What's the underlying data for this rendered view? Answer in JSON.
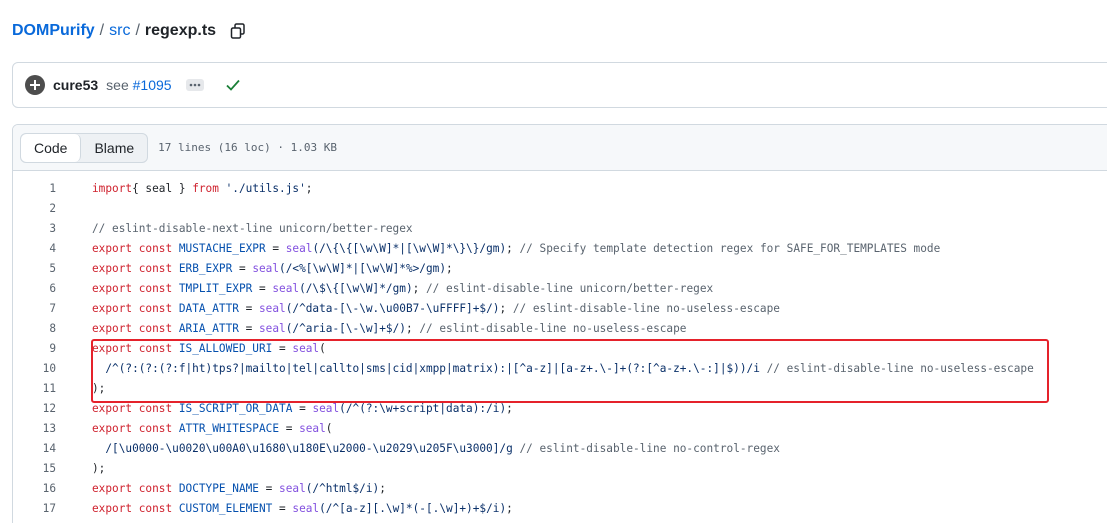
{
  "breadcrumb": {
    "repo": "DOMPurify",
    "sep1": "/",
    "dir": "src",
    "sep2": "/",
    "file": "regexp.ts"
  },
  "commit": {
    "author": "cure53",
    "message_prefix": "see",
    "message_link": "#1095"
  },
  "file_header": {
    "tab_code": "Code",
    "tab_blame": "Blame",
    "meta": "17 lines (16 loc) · 1.03 KB"
  },
  "colors": {
    "accent": "#0969da",
    "highlight": "#e5222b",
    "success": "#1a7f37"
  },
  "lines": [
    {
      "n": "1",
      "tokens": [
        [
          "k",
          "import"
        ],
        [
          "",
          "{ seal } "
        ],
        [
          "k",
          "from"
        ],
        [
          "s",
          " './utils.js'"
        ],
        [
          "",
          ";"
        ]
      ]
    },
    {
      "n": "2",
      "tokens": []
    },
    {
      "n": "3",
      "tokens": [
        [
          "c",
          "// eslint-disable-next-line unicorn/better-regex"
        ]
      ]
    },
    {
      "n": "4",
      "tokens": [
        [
          "k",
          "export const"
        ],
        [
          "v",
          " MUSTACHE_EXPR"
        ],
        [
          "",
          " = "
        ],
        [
          "f",
          "seal"
        ],
        [
          "s",
          "(/\\{\\{[\\w\\W]*|[\\w\\W]*\\}\\}/gm)"
        ],
        [
          "",
          "; "
        ],
        [
          "c",
          "// Specify template detection regex for SAFE_FOR_TEMPLATES mode"
        ]
      ]
    },
    {
      "n": "5",
      "tokens": [
        [
          "k",
          "export const"
        ],
        [
          "v",
          " ERB_EXPR"
        ],
        [
          "",
          " = "
        ],
        [
          "f",
          "seal"
        ],
        [
          "s",
          "(/<%[\\w\\W]*|[\\w\\W]*%>/gm)"
        ],
        [
          "",
          ";"
        ]
      ]
    },
    {
      "n": "6",
      "tokens": [
        [
          "k",
          "export const"
        ],
        [
          "v",
          " TMPLIT_EXPR"
        ],
        [
          "",
          " = "
        ],
        [
          "f",
          "seal"
        ],
        [
          "s",
          "(/\\$\\{[\\w\\W]*/gm)"
        ],
        [
          "",
          "; "
        ],
        [
          "c",
          "// eslint-disable-line unicorn/better-regex"
        ]
      ]
    },
    {
      "n": "7",
      "tokens": [
        [
          "k",
          "export const"
        ],
        [
          "v",
          " DATA_ATTR"
        ],
        [
          "",
          " = "
        ],
        [
          "f",
          "seal"
        ],
        [
          "s",
          "(/^data-[\\-\\w.\\u00B7-\\uFFFF]+$/)"
        ],
        [
          "",
          "; "
        ],
        [
          "c",
          "// eslint-disable-line no-useless-escape"
        ]
      ]
    },
    {
      "n": "8",
      "tokens": [
        [
          "k",
          "export const"
        ],
        [
          "v",
          " ARIA_ATTR"
        ],
        [
          "",
          " = "
        ],
        [
          "f",
          "seal"
        ],
        [
          "s",
          "(/^aria-[\\-\\w]+$/)"
        ],
        [
          "",
          "; "
        ],
        [
          "c",
          "// eslint-disable-line no-useless-escape"
        ]
      ]
    },
    {
      "n": "9",
      "tokens": [
        [
          "k",
          "export const"
        ],
        [
          "v",
          " IS_ALLOWED_URI"
        ],
        [
          "",
          " = "
        ],
        [
          "f",
          "seal"
        ],
        [
          "",
          "("
        ]
      ]
    },
    {
      "n": "10",
      "tokens": [
        [
          "s",
          "  /^(?:(?:(?:f|ht)tps?|mailto|tel|callto|sms|cid|xmpp|matrix):|[^a-z]|[a-z+.\\-]+(?:[^a-z+.\\-:]|$))/i"
        ],
        [
          "c",
          " // eslint-disable-line no-useless-escape"
        ]
      ]
    },
    {
      "n": "11",
      "tokens": [
        [
          "",
          ");"
        ]
      ]
    },
    {
      "n": "12",
      "tokens": [
        [
          "k",
          "export const"
        ],
        [
          "v",
          " IS_SCRIPT_OR_DATA"
        ],
        [
          "",
          " = "
        ],
        [
          "f",
          "seal"
        ],
        [
          "s",
          "(/^(?:\\w+script|data):/i)"
        ],
        [
          "",
          ";"
        ]
      ]
    },
    {
      "n": "13",
      "tokens": [
        [
          "k",
          "export const"
        ],
        [
          "v",
          " ATTR_WHITESPACE"
        ],
        [
          "",
          " = "
        ],
        [
          "f",
          "seal"
        ],
        [
          "",
          "("
        ]
      ]
    },
    {
      "n": "14",
      "tokens": [
        [
          "s",
          "  /[\\u0000-\\u0020\\u00A0\\u1680\\u180E\\u2000-\\u2029\\u205F\\u3000]/g"
        ],
        [
          "c",
          " // eslint-disable-line no-control-regex"
        ]
      ]
    },
    {
      "n": "15",
      "tokens": [
        [
          "",
          ");"
        ]
      ]
    },
    {
      "n": "16",
      "tokens": [
        [
          "k",
          "export const"
        ],
        [
          "v",
          " DOCTYPE_NAME"
        ],
        [
          "",
          " = "
        ],
        [
          "f",
          "seal"
        ],
        [
          "s",
          "(/^html$/i)"
        ],
        [
          "",
          ";"
        ]
      ]
    },
    {
      "n": "17",
      "tokens": [
        [
          "k",
          "export const"
        ],
        [
          "v",
          " CUSTOM_ELEMENT"
        ],
        [
          "",
          " = "
        ],
        [
          "f",
          "seal"
        ],
        [
          "s",
          "(/^[a-z][.\\w]*(-[.\\w]+)+$/i)"
        ],
        [
          "",
          ";"
        ]
      ]
    }
  ]
}
